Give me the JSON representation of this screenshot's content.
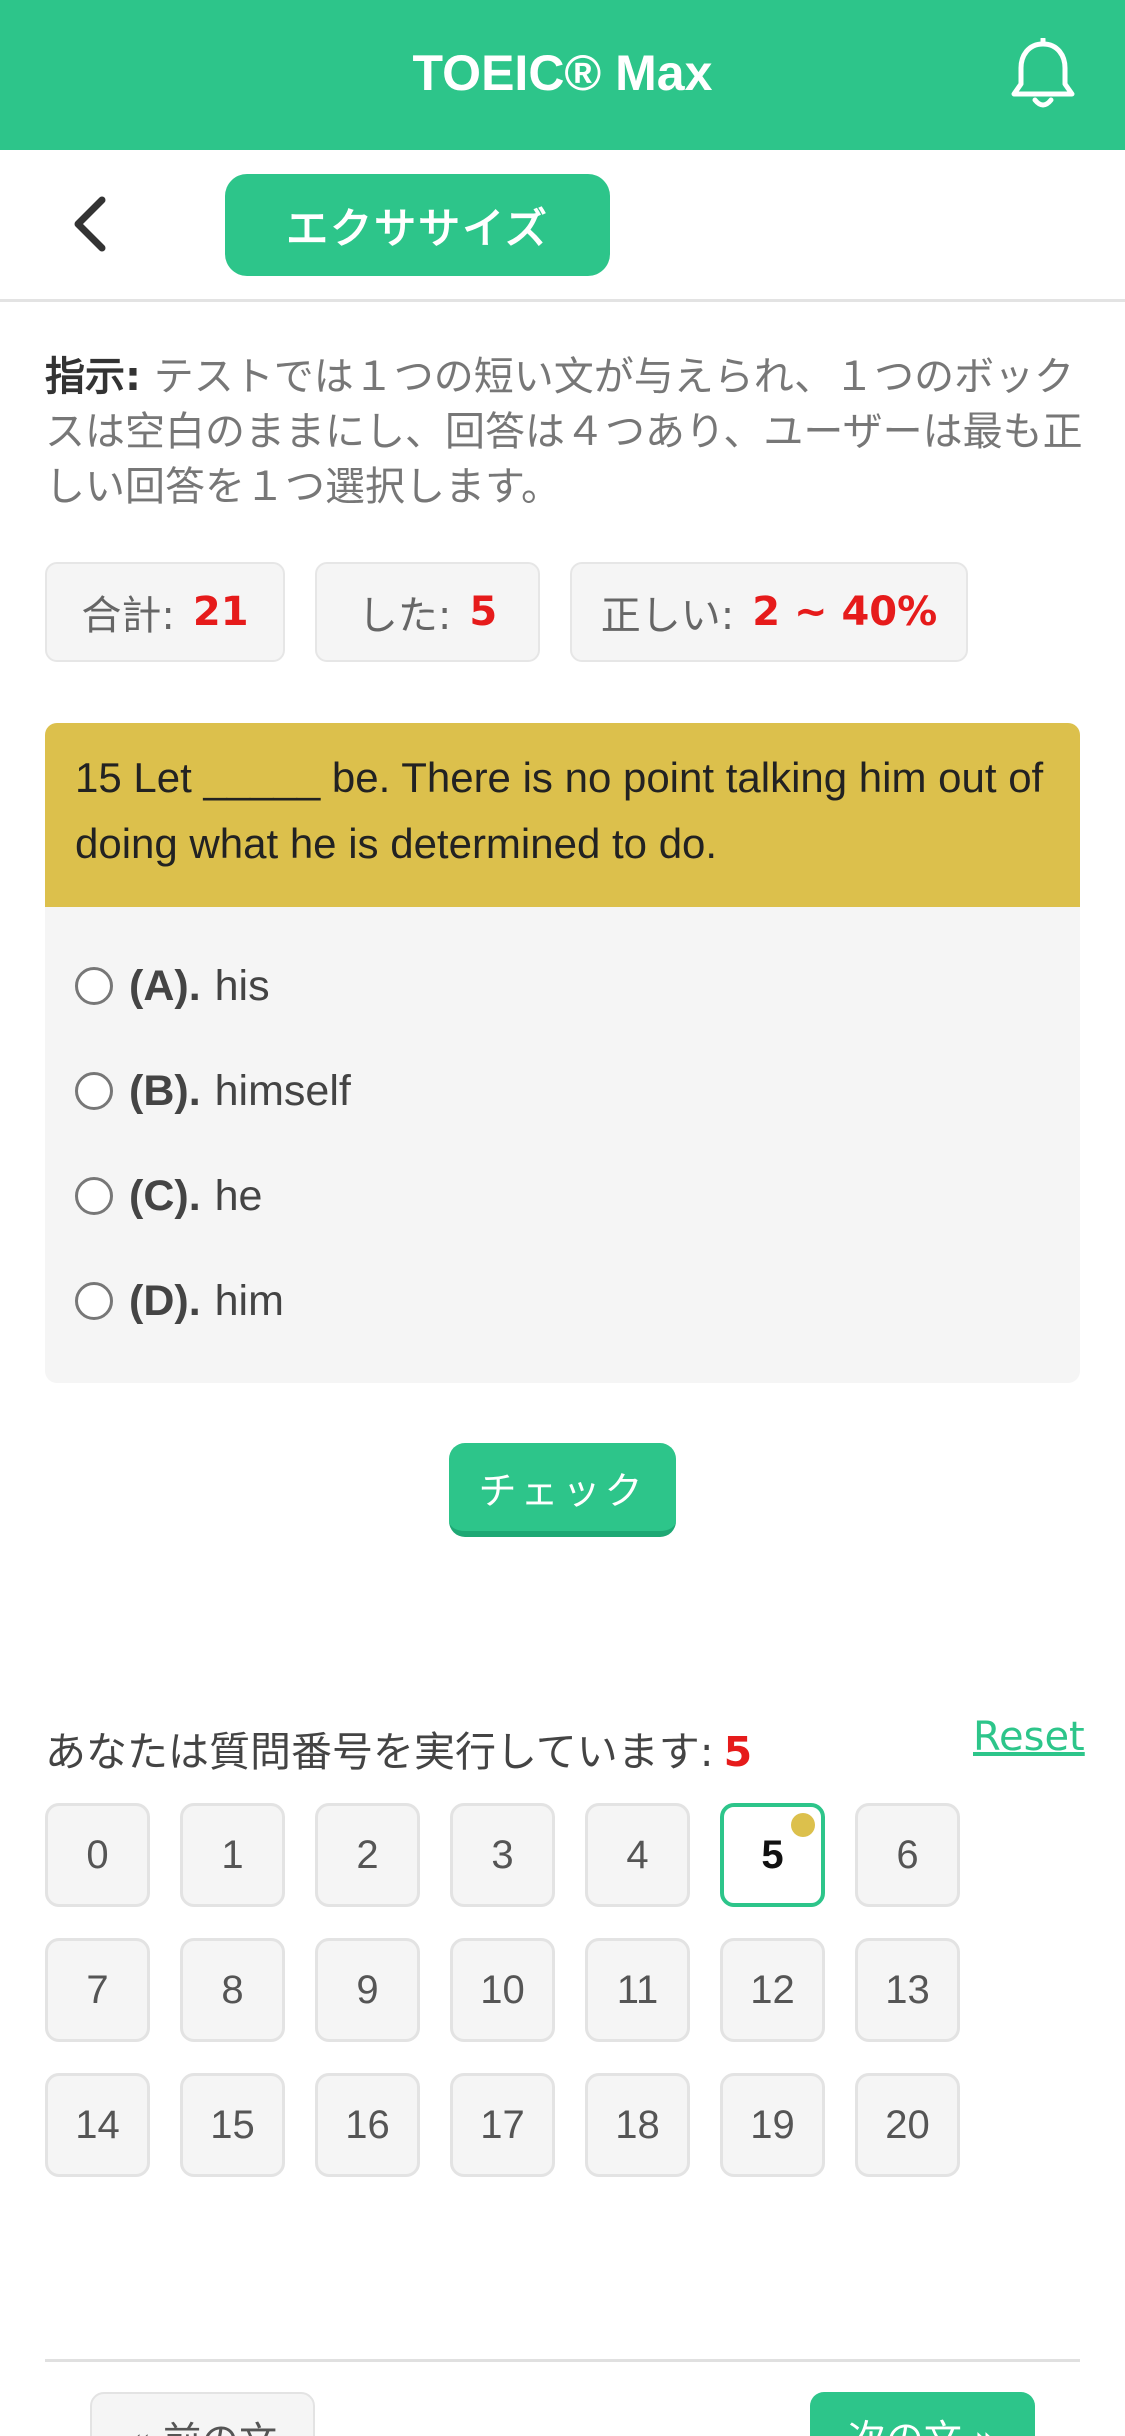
{
  "app": {
    "title": "TOEIC® Max",
    "bell_icon": "bell-icon",
    "accent": "#2dc58a"
  },
  "subnav": {
    "back_icon": "chevron-left-icon",
    "mode_label": "エクササイズ"
  },
  "instructions": {
    "label": "指示:",
    "text": " テストでは１つの短い文が与えられ、１つのボックスは空白のままにし、回答は４つあり、ユーザーは最も正しい回答を１つ選択します。"
  },
  "stats": {
    "total_label": "合計:",
    "total_value": "21",
    "done_label": "した:",
    "done_value": "5",
    "correct_label": "正しい:",
    "correct_value": "2 ~ 40%"
  },
  "question": {
    "text": "15 Let _____ be. There is no point talking him out of doing what he is determined to do.",
    "options": [
      {
        "key": "(A).",
        "text": "his"
      },
      {
        "key": "(B).",
        "text": "himself"
      },
      {
        "key": "(C).",
        "text": "he"
      },
      {
        "key": "(D).",
        "text": "him"
      }
    ],
    "check_label": "チェック"
  },
  "progress": {
    "label": "あなたは質問番号を実行しています:",
    "current": "5",
    "reset_label": "Reset",
    "numbers": [
      "0",
      "1",
      "2",
      "3",
      "4",
      "5",
      "6",
      "7",
      "8",
      "9",
      "10",
      "11",
      "12",
      "13",
      "14",
      "15",
      "16",
      "17",
      "18",
      "19",
      "20"
    ],
    "active_index": 5
  },
  "footer": {
    "prev_label": "« 前の文",
    "next_label": "次の文 »"
  }
}
